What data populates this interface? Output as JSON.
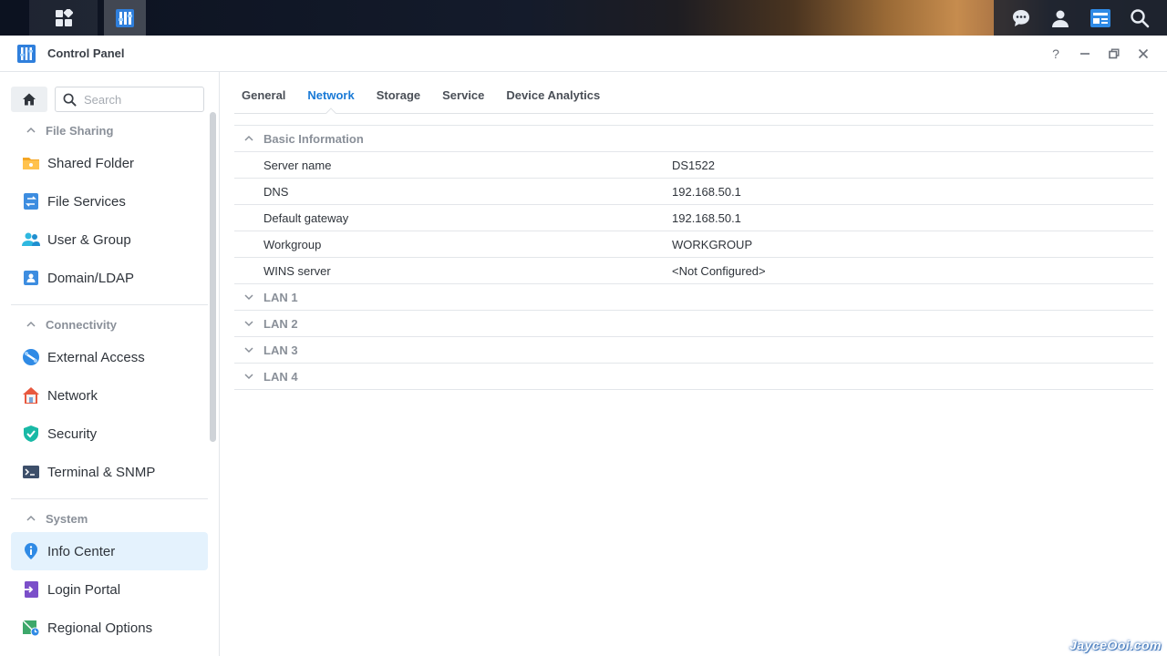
{
  "window": {
    "title": "Control Panel"
  },
  "taskbar": {
    "left": [
      {
        "name": "main-menu",
        "icon": "grid-icon"
      },
      {
        "name": "control-panel",
        "icon": "control-panel-icon"
      }
    ],
    "right": [
      {
        "name": "notifications",
        "icon": "chat-icon"
      },
      {
        "name": "user",
        "icon": "user-icon"
      },
      {
        "name": "widgets",
        "icon": "widgets-icon"
      },
      {
        "name": "search",
        "icon": "search-icon"
      }
    ]
  },
  "window_controls": {
    "help": "?"
  },
  "sidebar": {
    "search_placeholder": "Search",
    "sections": [
      {
        "label": "File Sharing",
        "items": [
          {
            "label": "Shared Folder",
            "icon": "folder-icon"
          },
          {
            "label": "File Services",
            "icon": "file-services-icon"
          },
          {
            "label": "User & Group",
            "icon": "users-icon"
          },
          {
            "label": "Domain/LDAP",
            "icon": "domain-icon"
          }
        ]
      },
      {
        "label": "Connectivity",
        "items": [
          {
            "label": "External Access",
            "icon": "external-access-icon"
          },
          {
            "label": "Network",
            "icon": "network-house-icon"
          },
          {
            "label": "Security",
            "icon": "shield-icon"
          },
          {
            "label": "Terminal & SNMP",
            "icon": "terminal-icon"
          }
        ]
      },
      {
        "label": "System",
        "items": [
          {
            "label": "Info Center",
            "icon": "info-icon",
            "active": true
          },
          {
            "label": "Login Portal",
            "icon": "login-portal-icon"
          },
          {
            "label": "Regional Options",
            "icon": "regional-icon"
          }
        ]
      }
    ]
  },
  "tabs": [
    {
      "label": "General"
    },
    {
      "label": "Network",
      "active": true
    },
    {
      "label": "Storage"
    },
    {
      "label": "Service"
    },
    {
      "label": "Device Analytics"
    }
  ],
  "basic_info": {
    "title": "Basic Information",
    "rows": [
      {
        "key": "Server name",
        "value": "DS1522"
      },
      {
        "key": "DNS",
        "value": "192.168.50.1"
      },
      {
        "key": "Default gateway",
        "value": "192.168.50.1"
      },
      {
        "key": "Workgroup",
        "value": "WORKGROUP"
      },
      {
        "key": "WINS server",
        "value": "<Not Configured>"
      }
    ]
  },
  "lan_groups": [
    {
      "label": "LAN 1"
    },
    {
      "label": "LAN 2"
    },
    {
      "label": "LAN 3"
    },
    {
      "label": "LAN 4"
    }
  ],
  "watermark": "JayceOoi.com",
  "colors": {
    "accent": "#1a7ad6",
    "active_bg": "#e4f2fd",
    "muted": "#8a9099"
  }
}
